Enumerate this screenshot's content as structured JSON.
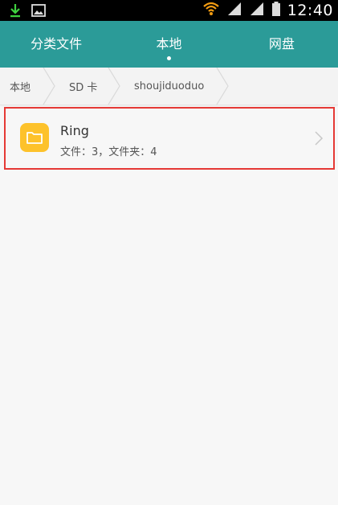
{
  "status_bar": {
    "time": "12:40",
    "icons": [
      "download-icon",
      "image-icon",
      "wifi-icon",
      "signal-icon",
      "signal-icon-2",
      "battery-icon"
    ]
  },
  "tabs": [
    {
      "label": "分类文件",
      "active": false
    },
    {
      "label": "本地",
      "active": true
    },
    {
      "label": "网盘",
      "active": false
    }
  ],
  "breadcrumb": [
    "本地",
    "SD 卡",
    "shoujiduoduo"
  ],
  "list": [
    {
      "title": "Ring",
      "subtitle": "文件：3，文件夹：4",
      "icon": "folder-icon"
    }
  ],
  "colors": {
    "tab_bar": "#2b9b98",
    "folder": "#fdc22b",
    "highlight_border": "#e53935",
    "status_bar": "#000000"
  }
}
